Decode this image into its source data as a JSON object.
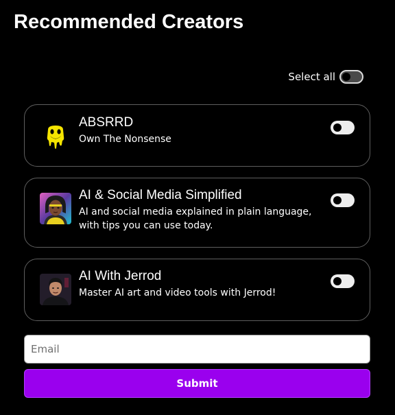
{
  "header": {
    "title": "Recommended Creators"
  },
  "select_all": {
    "label": "Select all",
    "checked": false
  },
  "creators": [
    {
      "name": "ABSRRD",
      "description": "Own The Nonsense",
      "avatar_icon": "melting-smiley-logo-icon",
      "subscribed": false
    },
    {
      "name": "AI & Social Media Simplified",
      "description": "AI and social media explained in plain language, with tips you can use today.",
      "avatar_icon": "woman-portrait-avatar",
      "subscribed": false
    },
    {
      "name": "AI With Jerrod",
      "description": "Master AI art and video tools with Jerrod!",
      "avatar_icon": "man-portrait-avatar",
      "subscribed": false
    }
  ],
  "form": {
    "email_placeholder": "Email",
    "email_value": "",
    "submit_label": "Submit"
  },
  "colors": {
    "background": "#000000",
    "accent": "#9a00ee",
    "card_border": "#5f5f5f",
    "logo_yellow": "#f5e400"
  }
}
